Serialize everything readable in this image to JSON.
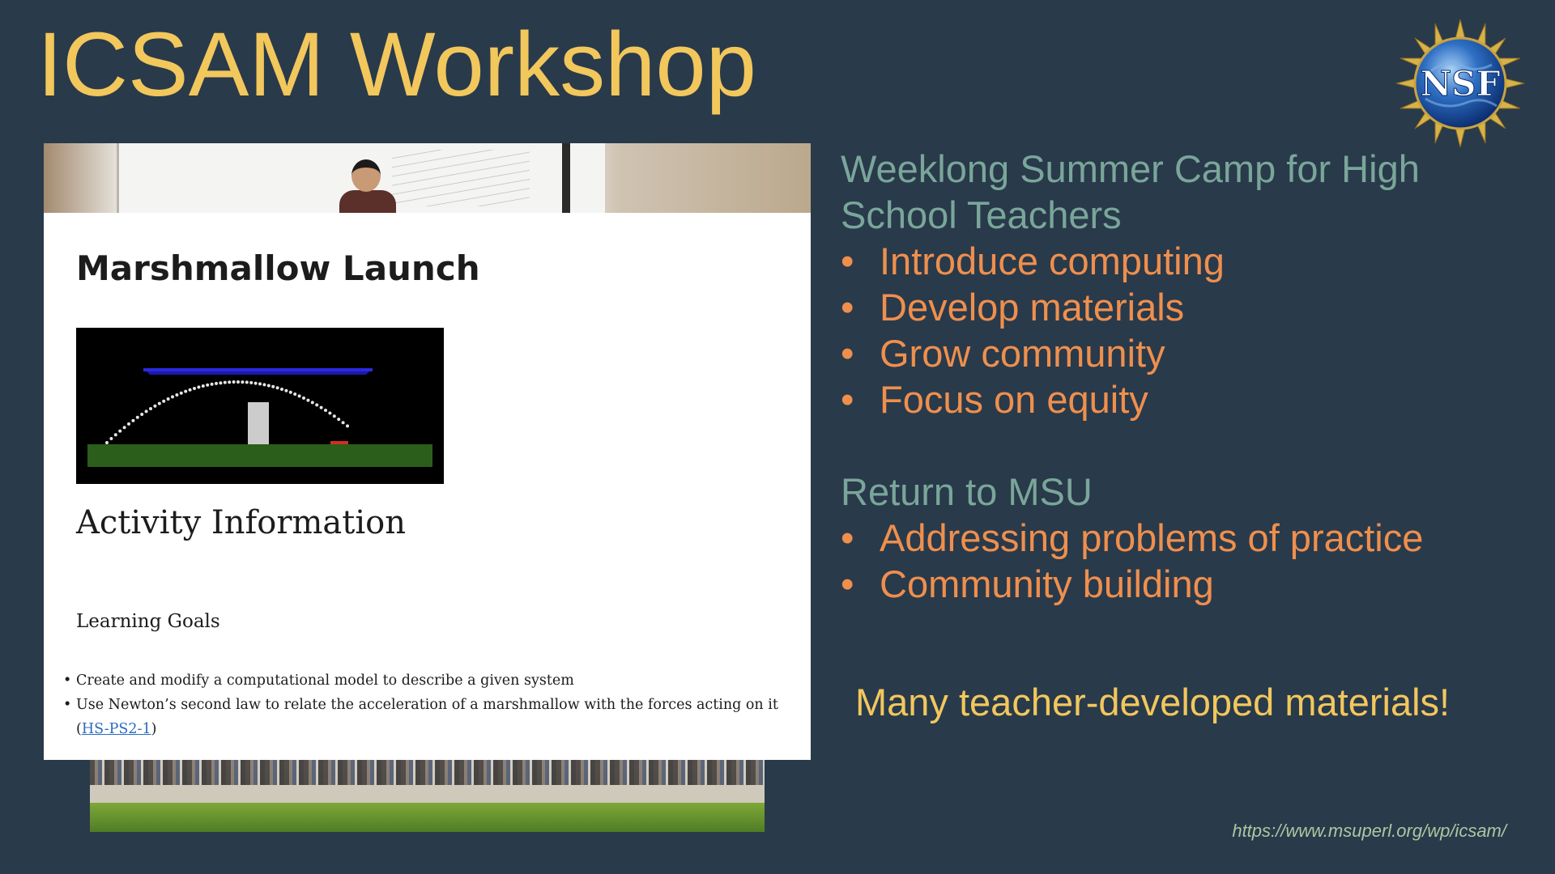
{
  "slide": {
    "title": "ICSAM Workshop",
    "logo_text": "NSF",
    "logo_icon": "nsf-seal-icon"
  },
  "webpage": {
    "title": "Marshmallow Launch",
    "activity_heading": "Activity Information",
    "goals_heading": "Learning Goals",
    "goals": [
      {
        "text": "Create and modify a computational model to describe a given system"
      },
      {
        "text_before": "Use Newton’s second law to relate the acceleration of a marshmallow with the forces acting on it (",
        "link": "HS-PS2-1",
        "text_after": ")"
      }
    ]
  },
  "right": {
    "section1_heading_line1": "Weeklong Summer Camp for High",
    "section1_heading_line2": "School Teachers",
    "section1_bullets": [
      "Introduce computing",
      "Develop materials",
      "Grow community",
      "Focus on equity"
    ],
    "section2_heading": "Return to MSU",
    "section2_bullets": [
      "Addressing problems of practice",
      "Community building"
    ],
    "bullet_glyph": "•"
  },
  "tagline": "Many teacher-developed materials!",
  "url": "https://www.msuperl.org/wp/icsam/",
  "colors": {
    "background": "#293a4b",
    "title": "#f2c75c",
    "section_heading": "#7aa69a",
    "bullet_text": "#ef8f4d",
    "url": "#a9c9a0"
  }
}
